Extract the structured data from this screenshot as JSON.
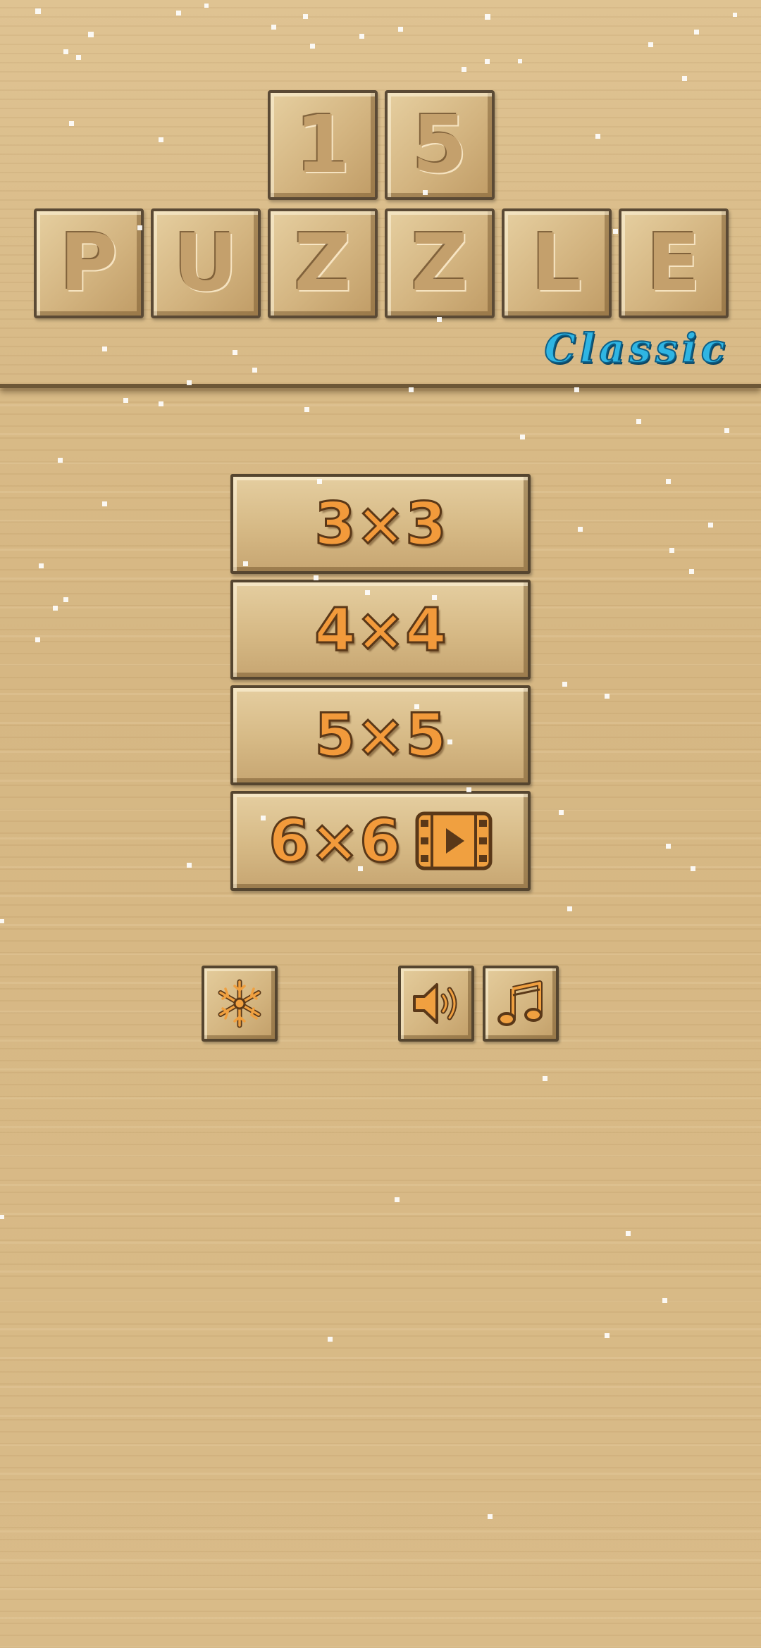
{
  "title": {
    "number_tiles": [
      "1",
      "5"
    ],
    "word_tiles": [
      "P",
      "U",
      "Z",
      "Z",
      "L",
      "E"
    ],
    "subtitle": "Classic"
  },
  "menu": {
    "modes": [
      {
        "label": "3×3",
        "video": false
      },
      {
        "label": "4×4",
        "video": false
      },
      {
        "label": "5×5",
        "video": false
      },
      {
        "label": "6×6",
        "video": true
      }
    ]
  },
  "controls": {
    "snow_toggle_icon": "snowflake-icon",
    "sound_toggle_icon": "speaker-icon",
    "music_toggle_icon": "music-note-icon"
  },
  "colors": {
    "subtitle": "#2fb5e3",
    "button_text": "#f29a3b",
    "icon_fill": "#f0a040"
  }
}
